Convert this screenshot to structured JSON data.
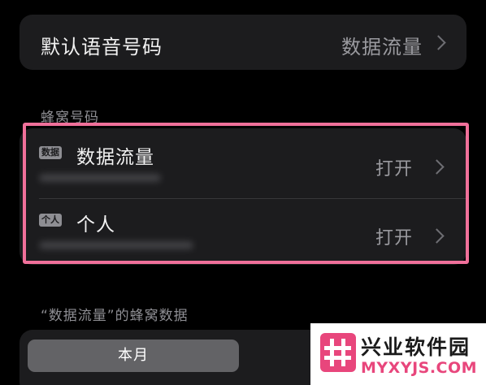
{
  "default_voice": {
    "label": "默认语音号码",
    "value": "数据流量"
  },
  "cellular_section": {
    "header": "蜂窝号码",
    "lines": [
      {
        "badge": "数据",
        "name": "数据流量",
        "status": "打开"
      },
      {
        "badge": "个人",
        "name": "个人",
        "status": "打开"
      }
    ]
  },
  "usage_section": {
    "header": "“数据流量”的蜂窝数据",
    "segment_selected": "本月"
  },
  "watermark": {
    "title": "兴业软件园",
    "url": "MYXYJS.COM"
  },
  "colors": {
    "highlight": "#f0709a",
    "watermark_url": "#e8467c"
  }
}
